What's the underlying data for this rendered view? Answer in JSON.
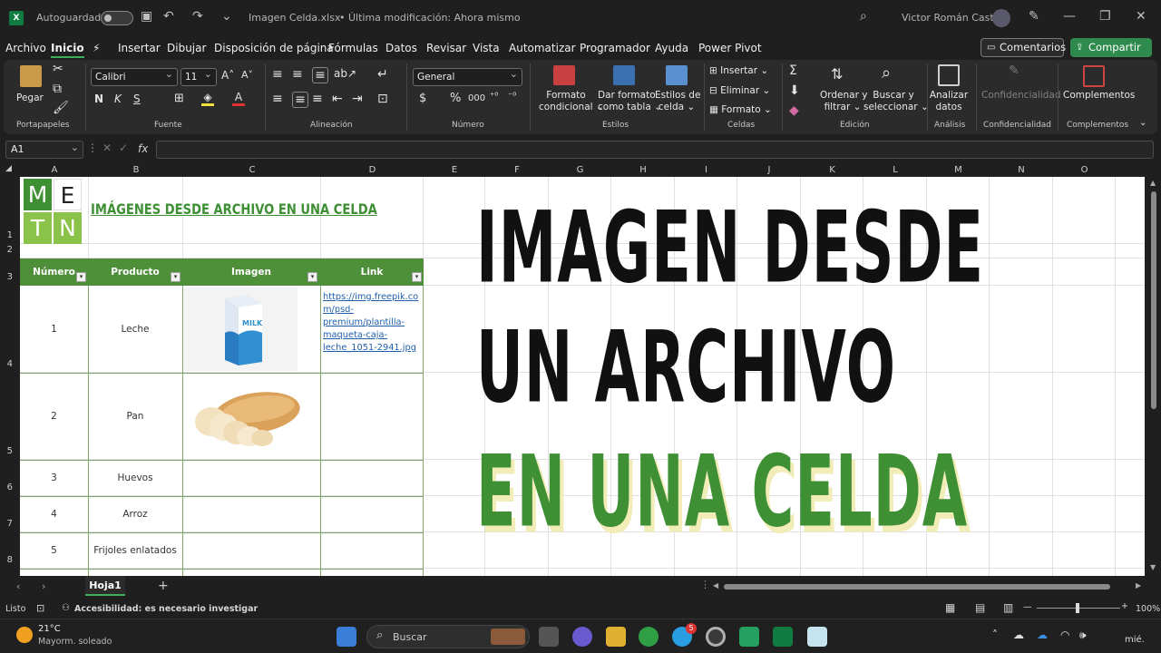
{
  "titlebar": {
    "autosave_label": "Autoguardado",
    "file_name": "Imagen Celda.xlsx",
    "modified": "• Última modificación: Ahora mismo",
    "user": "Victor Román Castro"
  },
  "menu": {
    "items": [
      "Archivo",
      "Inicio",
      "Insertar",
      "Dibujar",
      "Disposición de página",
      "Fórmulas",
      "Datos",
      "Revisar",
      "Vista",
      "Automatizar",
      "Programador",
      "Ayuda",
      "Power Pivot"
    ],
    "active": "Inicio",
    "comments_label": "Comentarios",
    "share_label": "Compartir"
  },
  "ribbon": {
    "paste_label": "Pegar",
    "font_name": "Calibri",
    "font_size": "11",
    "number_format": "General",
    "conditional_format": "Formato",
    "conditional_format_2": "condicional",
    "format_table": "Dar formato",
    "format_table_2": "como tabla",
    "cell_styles": "Estilos de",
    "cell_styles_2": "celda",
    "insert": "Insertar",
    "delete": "Eliminar",
    "format": "Formato",
    "sort_filter": "Ordenar y",
    "sort_filter_2": "filtrar",
    "find_select": "Buscar y",
    "find_select_2": "seleccionar",
    "analyze": "Analizar",
    "analyze_2": "datos",
    "confidentiality": "Confidencialidad",
    "addins": "Complementos",
    "groups": [
      "Portapapeles",
      "Fuente",
      "Alineación",
      "Número",
      "Estilos",
      "Celdas",
      "Edición",
      "Análisis",
      "Confidencialidad",
      "Complementos"
    ]
  },
  "formula_bar": {
    "name_box": "A1",
    "fx": "fx"
  },
  "columns": [
    "A",
    "B",
    "C",
    "D",
    "E",
    "F",
    "G",
    "H",
    "I",
    "J",
    "K",
    "L",
    "M",
    "N",
    "O"
  ],
  "rows": [
    "1",
    "2",
    "3",
    "4",
    "5",
    "6",
    "7",
    "8"
  ],
  "logo": {
    "letters": [
      "M",
      "E",
      "T",
      "N"
    ]
  },
  "sheet_title": "IMÁGENES DESDE ARCHIVO EN UNA CELDA",
  "table": {
    "headers": [
      "Número",
      "Producto",
      "Imagen",
      "Link"
    ],
    "rows": [
      {
        "num": "1",
        "product": "Leche",
        "link": "https://img.freepik.com/psd-premium/plantilla-maqueta-caja-leche_1051-2941.jpg"
      },
      {
        "num": "2",
        "product": "Pan",
        "link": ""
      },
      {
        "num": "3",
        "product": "Huevos",
        "link": ""
      },
      {
        "num": "4",
        "product": "Arroz",
        "link": ""
      },
      {
        "num": "5",
        "product": "Frijoles enlatados",
        "link": ""
      }
    ],
    "link_lines": [
      "https://img.freepik.co",
      "m/psd-",
      "premium/plantilla-",
      "maqueta-caja-",
      "leche_1051-2941.jpg"
    ]
  },
  "overlay": {
    "line1": "IMAGEN DESDE",
    "line2": "UN ARCHIVO",
    "line3": "EN UNA CELDA",
    "color_dark": "#111111",
    "color_green": "#3f8f35"
  },
  "sheets": {
    "active": "Hoja1"
  },
  "status": {
    "ready": "Listo",
    "accessibility": "Accesibilidad: es necesario investigar",
    "zoom": "100%"
  },
  "taskbar": {
    "temp": "21°C",
    "weather": "Mayorm. soleado",
    "search": "Buscar",
    "badge": "5",
    "day": "mié."
  }
}
